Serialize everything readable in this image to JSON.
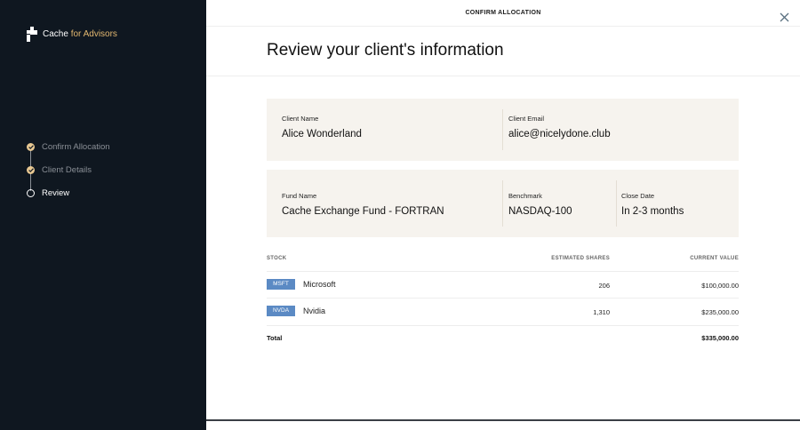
{
  "brand": {
    "name": "Cache",
    "suffix": "for Advisors",
    "accent_color": "#e3b870"
  },
  "steps": [
    {
      "label": "Confirm Allocation",
      "status": "done"
    },
    {
      "label": "Client Details",
      "status": "done"
    },
    {
      "label": "Review",
      "status": "current"
    }
  ],
  "topbar": {
    "title": "CONFIRM ALLOCATION"
  },
  "page": {
    "title": "Review your client's information"
  },
  "client": {
    "name_label": "Client Name",
    "name": "Alice Wonderland",
    "email_label": "Client Email",
    "email": "alice@nicelydone.club"
  },
  "fund": {
    "name_label": "Fund Name",
    "name": "Cache Exchange Fund - FORTRAN",
    "benchmark_label": "Benchmark",
    "benchmark": "NASDAQ-100",
    "close_label": "Close Date",
    "close": "In 2-3 months"
  },
  "table": {
    "headers": {
      "stock": "STOCK",
      "shares": "ESTIMATED SHARES",
      "value": "CURRENT VALUE"
    },
    "rows": [
      {
        "ticker": "MSFT",
        "name": "Microsoft",
        "shares": "206",
        "value": "$100,000.00"
      },
      {
        "ticker": "NVDA",
        "name": "Nvidia",
        "shares": "1,310",
        "value": "$235,000.00"
      }
    ],
    "total_label": "Total",
    "total_value": "$335,000.00"
  },
  "icons": {
    "close": "close-icon",
    "check": "check-icon"
  }
}
